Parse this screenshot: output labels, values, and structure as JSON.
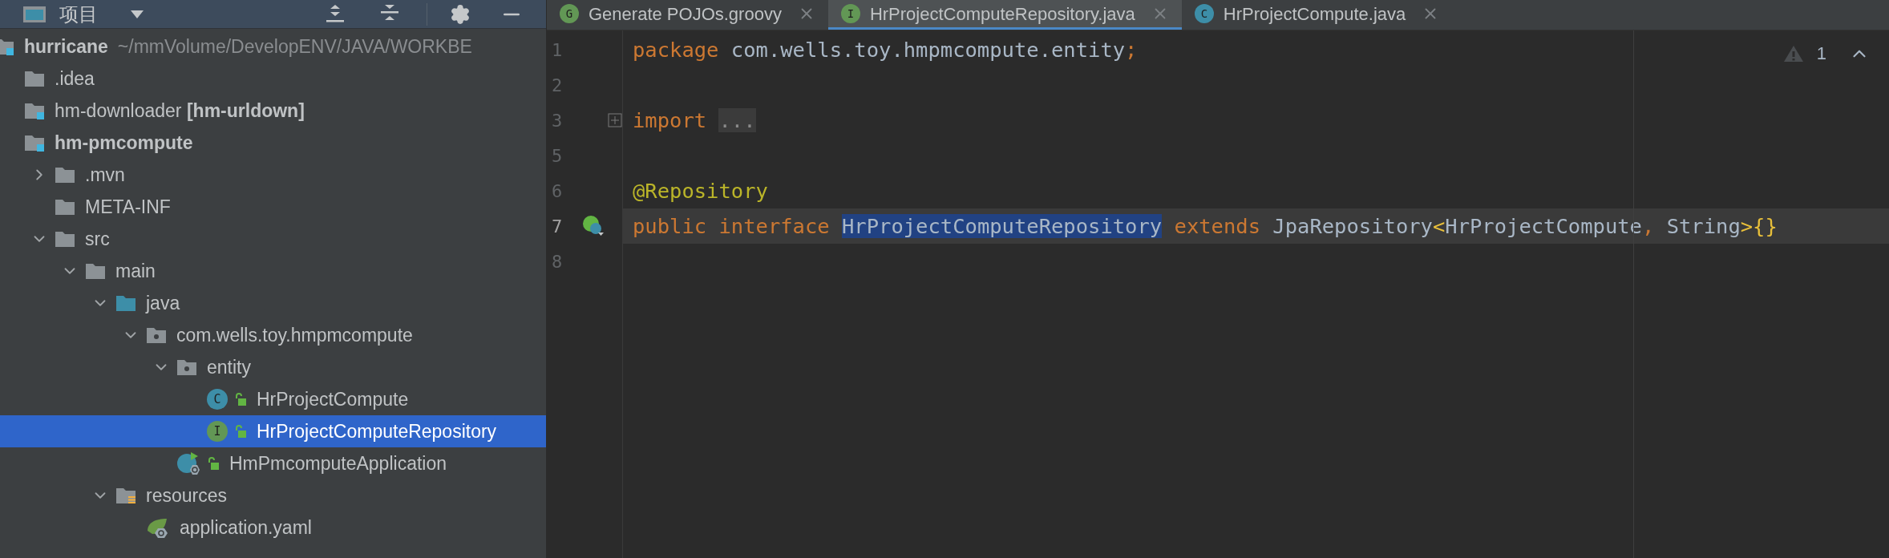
{
  "project_panel": {
    "title": "项目",
    "tree": [
      {
        "label": "hurricane",
        "path": "~/mmVolume/DevelopENV/JAVA/WORKBE",
        "kind": "module",
        "bold": true,
        "selected": false,
        "children": [
          {
            "label": ".idea",
            "kind": "folder",
            "bold": false,
            "selected": false
          },
          {
            "label": "hm-downloader **[hm-urldown]**",
            "kind": "module",
            "bold": false,
            "selected": false
          },
          {
            "label": "hm-pmcompute",
            "kind": "module",
            "bold": true,
            "selected": false,
            "children": [
              {
                "label": ".mvn",
                "kind": "folder",
                "expanded": false,
                "bold": false,
                "selected": false
              },
              {
                "label": "META-INF",
                "kind": "folder",
                "bold": false,
                "selected": false
              },
              {
                "label": "src",
                "kind": "folder",
                "expanded": true,
                "bold": false,
                "selected": false,
                "children": [
                  {
                    "label": "main",
                    "kind": "folder",
                    "expanded": true,
                    "bold": false,
                    "selected": false,
                    "children": [
                      {
                        "label": "java",
                        "kind": "source-root",
                        "expanded": true,
                        "bold": false,
                        "selected": false,
                        "children": [
                          {
                            "label": "com.wells.toy.hmpmcompute",
                            "kind": "package",
                            "expanded": true,
                            "bold": false,
                            "selected": false,
                            "children": [
                              {
                                "label": "entity",
                                "kind": "package",
                                "expanded": true,
                                "bold": false,
                                "selected": false,
                                "children": [
                                  {
                                    "label": "HrProjectCompute",
                                    "kind": "class",
                                    "badge": "C",
                                    "color": "#3d8ea8",
                                    "bold": false,
                                    "selected": false
                                  },
                                  {
                                    "label": "HrProjectComputeRepository",
                                    "kind": "class",
                                    "badge": "I",
                                    "color": "#629755",
                                    "bold": false,
                                    "selected": true
                                  }
                                ]
                              },
                              {
                                "label": "HmPmcomputeApplication",
                                "kind": "spring-class",
                                "bold": false,
                                "selected": false
                              }
                            ]
                          }
                        ]
                      },
                      {
                        "label": "resources",
                        "kind": "resources",
                        "expanded": true,
                        "bold": false,
                        "selected": false,
                        "children": [
                          {
                            "label": "application.yaml",
                            "kind": "yaml",
                            "bold": false,
                            "selected": false
                          }
                        ]
                      }
                    ]
                  }
                ]
              }
            ]
          }
        ]
      }
    ]
  },
  "editor": {
    "tabs": [
      {
        "label": "Generate POJOs.groovy",
        "badge": "G",
        "color": "#629755",
        "selected": false
      },
      {
        "label": "HrProjectComputeRepository.java",
        "badge": "I",
        "color": "#629755",
        "selected": true
      },
      {
        "label": "HrProjectCompute.java",
        "badge": "C",
        "color": "#3d8ea8",
        "selected": false
      }
    ],
    "inspections": {
      "count": "1"
    },
    "lines": [
      {
        "number": "1",
        "kind": "plain",
        "current": false,
        "tokens": [
          {
            "text": "package",
            "kind": "keyword"
          },
          {
            "text": " com.wells.toy.hmpmcompute.entity",
            "kind": "plain"
          },
          {
            "text": ";",
            "kind": "keyword"
          }
        ]
      },
      {
        "number": "2",
        "kind": "plain",
        "current": false
      },
      {
        "number": "3",
        "kind": "fold",
        "current": false,
        "tokens": [
          {
            "text": "import ",
            "kind": "keyword"
          },
          {
            "text": "...",
            "kind": "folded"
          }
        ]
      },
      {
        "number": "5",
        "kind": "plain",
        "current": false
      },
      {
        "number": "6",
        "kind": "plain",
        "current": false,
        "tokens": [
          {
            "text": "@Repository",
            "kind": "annotation"
          }
        ]
      },
      {
        "number": "7",
        "kind": "implemented",
        "current": true,
        "tokens": [
          {
            "text": "public interface ",
            "kind": "keyword"
          },
          {
            "text": "HrProjectComputeRepository",
            "kind": "selected"
          },
          {
            "text": " extends",
            "kind": "keyword"
          },
          {
            "text": " JpaRepository",
            "kind": "plain"
          },
          {
            "text": "<",
            "kind": "bracket"
          },
          {
            "text": "HrProjectCompute",
            "kind": "plain"
          },
          {
            "text": ",",
            "kind": "keyword"
          },
          {
            "text": " String",
            "kind": "plain"
          },
          {
            "text": ">{}",
            "kind": "bracket"
          }
        ]
      },
      {
        "number": "8",
        "kind": "plain",
        "current": false
      }
    ]
  }
}
